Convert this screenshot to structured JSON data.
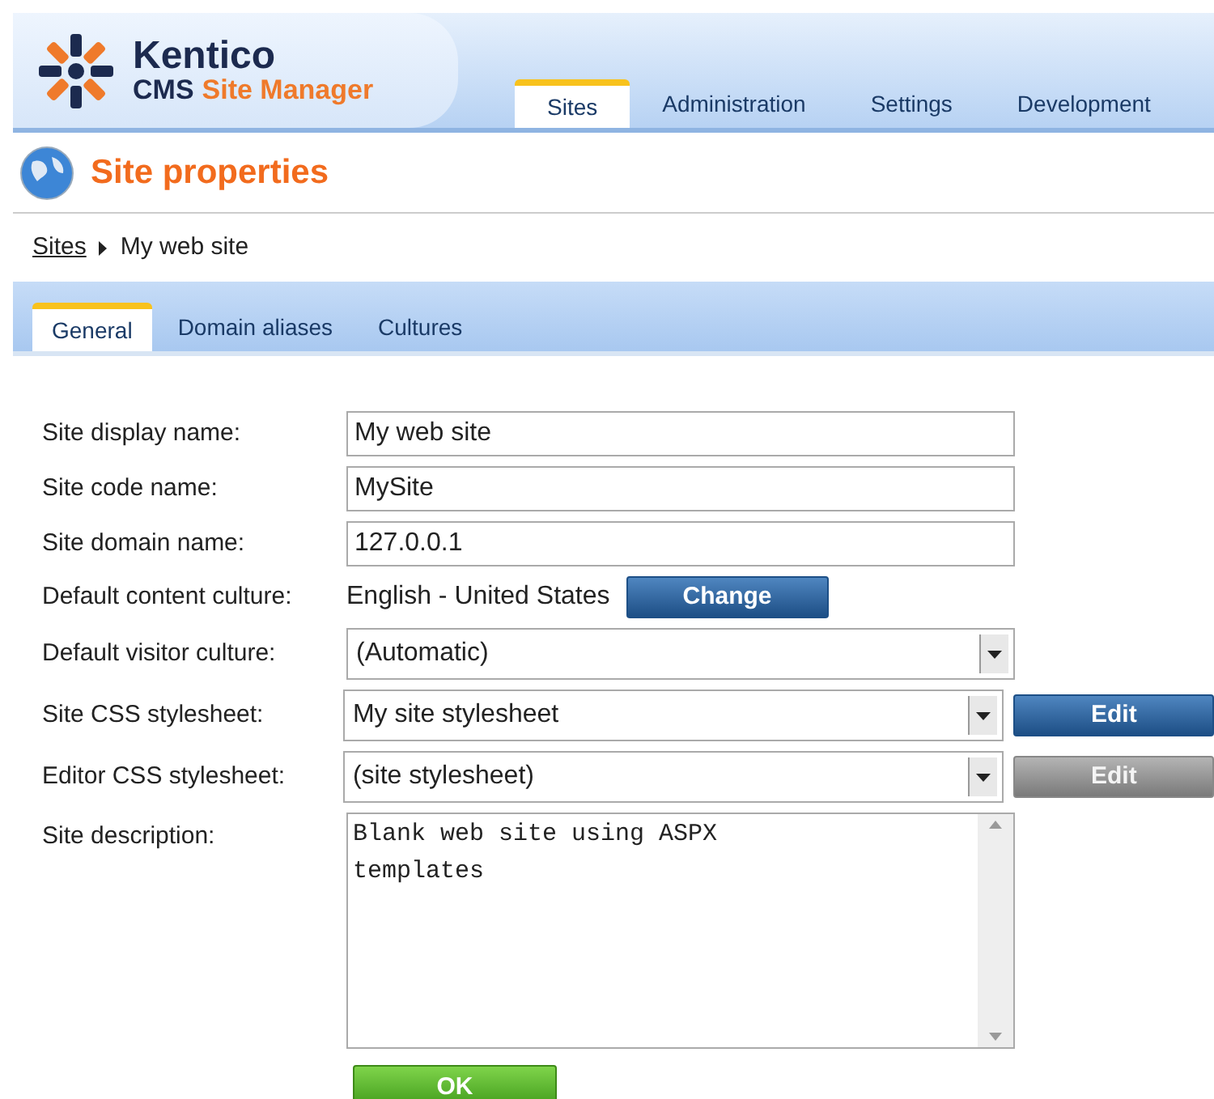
{
  "header": {
    "logo_name": "Kentico",
    "logo_product": "CMS",
    "logo_product_accent": "Site Manager",
    "tabs": [
      {
        "label": "Sites",
        "selected": true
      },
      {
        "label": "Administration",
        "selected": false
      },
      {
        "label": "Settings",
        "selected": false
      },
      {
        "label": "Development",
        "selected": false
      }
    ]
  },
  "page_title": "Site properties",
  "breadcrumb": {
    "link": "Sites",
    "current": "My web site"
  },
  "subtabs": [
    {
      "label": "General",
      "selected": true
    },
    {
      "label": "Domain aliases",
      "selected": false
    },
    {
      "label": "Cultures",
      "selected": false
    }
  ],
  "form": {
    "rows": [
      {
        "kind": "text",
        "label": "Site display name:",
        "value": "My web site"
      },
      {
        "kind": "text",
        "label": "Site code name:",
        "value": "MySite"
      },
      {
        "kind": "text",
        "label": "Site domain name:",
        "value": "127.0.0.1"
      },
      {
        "kind": "static",
        "label": "Default content culture:",
        "value": "English - United States",
        "button": {
          "label": "Change",
          "disabled": false
        }
      },
      {
        "kind": "select",
        "label": "Default visitor culture:",
        "value": "(Automatic)"
      },
      {
        "kind": "select",
        "label": "Site CSS stylesheet:",
        "value": "My site stylesheet",
        "button": {
          "label": "Edit",
          "disabled": false
        }
      },
      {
        "kind": "select",
        "label": "Editor CSS stylesheet:",
        "value": "(site stylesheet)",
        "button": {
          "label": "Edit",
          "disabled": true
        }
      },
      {
        "kind": "textarea",
        "label": "Site description:",
        "value": "Blank web site using ASPX\ntemplates"
      }
    ],
    "submit": "OK"
  }
}
